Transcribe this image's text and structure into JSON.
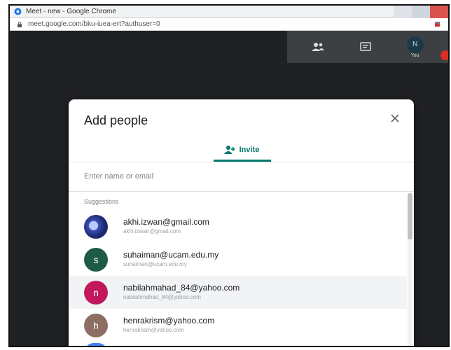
{
  "browser": {
    "window_title": "Meet - new - Google Chrome",
    "url": "meet.google.com/bku-iuea-ert?authuser=0"
  },
  "toolbar": {
    "self_label": "You",
    "self_initial": "N"
  },
  "dialog": {
    "title": "Add people",
    "tab_label": "Invite",
    "search_placeholder": "Enter name or email",
    "suggestions_label": "Suggestions",
    "suggestions": [
      {
        "name": "akhi.izwan@gmail.com",
        "email": "akhi.izwan@gmail.com",
        "initial": "",
        "color": "#2f4aa0"
      },
      {
        "name": "suhaiman@ucam.edu.my",
        "email": "suhaiman@ucam.edu.my",
        "initial": "s",
        "color": "#1e5b46"
      },
      {
        "name": "nabilahmahad_84@yahoo.com",
        "email": "nabilahmahad_84@yahoo.com",
        "initial": "n",
        "color": "#c2185b"
      },
      {
        "name": "henrakrism@yahoo.com",
        "email": "henrakrism@yahoo.com",
        "initial": "h",
        "color": "#8d6e63"
      }
    ]
  },
  "colors": {
    "accent": "#00796b",
    "meet_background": "#202124",
    "record": "#d93025"
  }
}
